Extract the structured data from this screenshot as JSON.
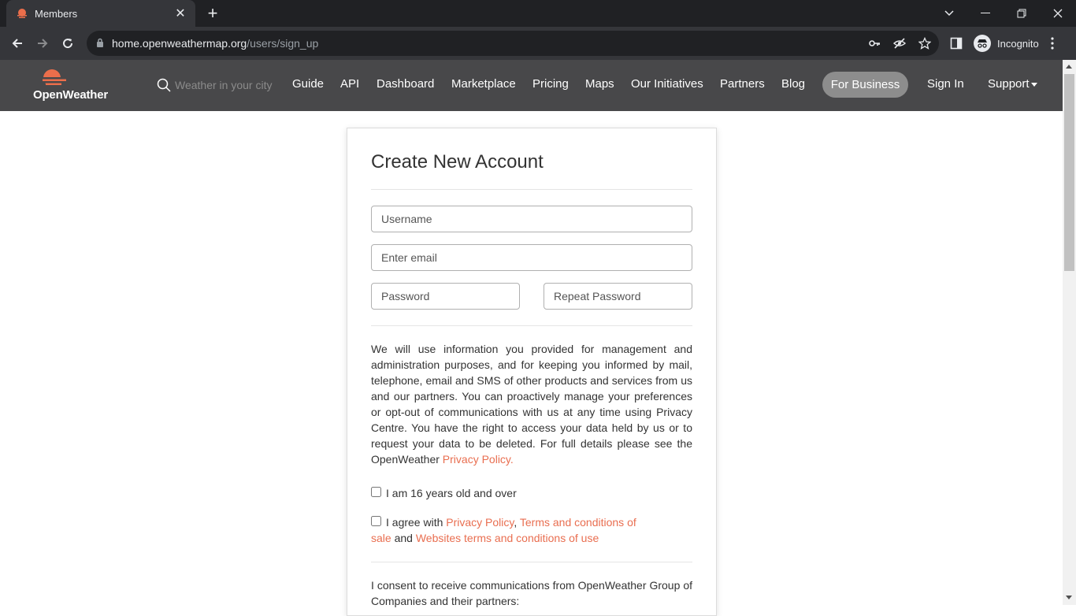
{
  "browser": {
    "tab_title": "Members",
    "url_host": "home.openweathermap.org",
    "url_path": "/users/sign_up",
    "profile_label": "Incognito"
  },
  "site": {
    "brand": "OpenWeather",
    "search_placeholder": "Weather in your city",
    "nav": [
      "Guide",
      "API",
      "Dashboard",
      "Marketplace",
      "Pricing",
      "Maps",
      "Our Initiatives",
      "Partners",
      "Blog"
    ],
    "business_label": "For Business",
    "signin_label": "Sign In",
    "support_label": "Support",
    "colors": {
      "header_bg": "#48484a",
      "brand_orange": "#eb6e4b",
      "link": "#e96e50"
    }
  },
  "form": {
    "title": "Create New Account",
    "username_placeholder": "Username",
    "email_placeholder": "Enter email",
    "password_placeholder": "Password",
    "repeat_password_placeholder": "Repeat Password",
    "notice_text": "We will use information you provided for management and administration purposes, and for keeping you informed by mail, telephone, email and SMS of other products and services from us and our partners. You can proactively manage your preferences or opt-out of communications with us at any time using Privacy Centre. You have the right to access your data held by us or to request your data to be deleted. For full details please see the OpenWeather ",
    "notice_link": "Privacy Policy.",
    "age_label": "I am 16 years old and over",
    "agree_prefix": "I agree with ",
    "agree_link1": "Privacy Policy",
    "agree_sep": ", ",
    "agree_link2": "Terms and conditions of sale",
    "agree_and": " and ",
    "agree_link3": "Websites terms and conditions of use",
    "consent_text": "I consent to receive communications from OpenWeather Group of Companies and their partners:"
  }
}
